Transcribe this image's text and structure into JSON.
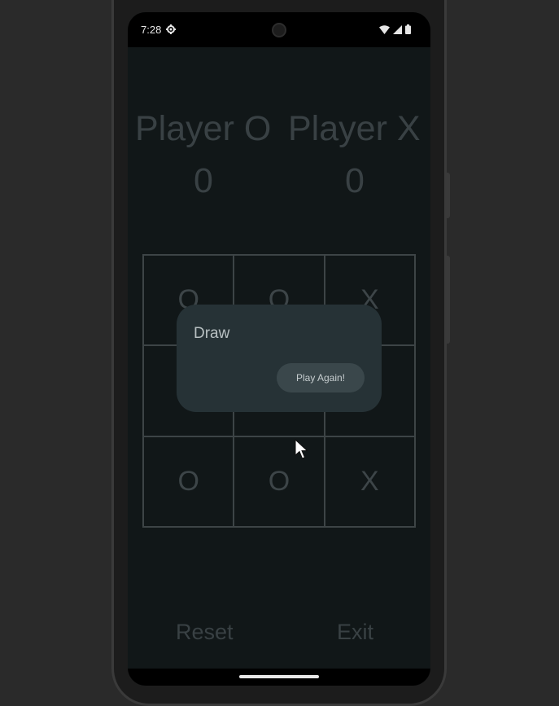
{
  "status_bar": {
    "time": "7:28",
    "icons": [
      "gear-icon",
      "wifi-icon",
      "signal-icon",
      "battery-icon"
    ]
  },
  "players": [
    {
      "label": "Player O",
      "score": "0"
    },
    {
      "label": "Player X",
      "score": "0"
    }
  ],
  "board": [
    "O",
    "O",
    "X",
    "",
    "",
    "",
    "O",
    "O",
    "X"
  ],
  "dialog": {
    "title": "Draw",
    "button_label": "Play Again!"
  },
  "buttons": {
    "reset_label": "Reset",
    "exit_label": "Exit"
  },
  "colors": {
    "app_background": "#111718",
    "dialog_background": "#263236",
    "dialog_button": "#3a474b",
    "dim_text": "#394144"
  }
}
